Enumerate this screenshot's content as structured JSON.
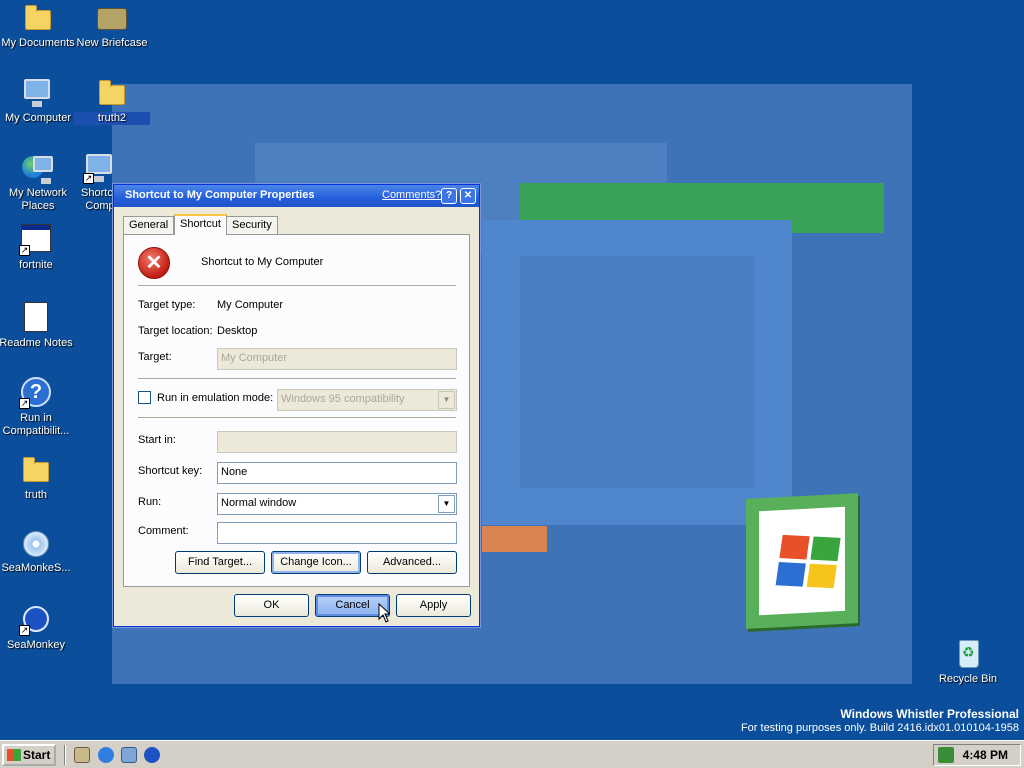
{
  "desktop_icons": [
    {
      "label": "My Documents",
      "icon": "my-documents-icon"
    },
    {
      "label": "New Briefcase",
      "icon": "briefcase-icon"
    },
    {
      "label": "My Computer",
      "icon": "my-computer-icon"
    },
    {
      "label": "truth2",
      "icon": "folder-icon"
    },
    {
      "label": "My Network Places",
      "icon": "network-places-icon"
    },
    {
      "label": "Shortcu Comp",
      "icon": "shortcut-my-computer-icon"
    },
    {
      "label": "fortnite",
      "icon": "app-window-icon"
    },
    {
      "label": "Readme Notes",
      "icon": "document-icon"
    },
    {
      "label": "Run in Compatibilit...",
      "icon": "help-icon"
    },
    {
      "label": "truth",
      "icon": "folder-icon"
    },
    {
      "label": "SeaMonkeS...",
      "icon": "cd-icon"
    },
    {
      "label": "SeaMonkey",
      "icon": "seamonkey-icon"
    },
    {
      "label": "Recycle Bin",
      "icon": "recycle-bin-icon"
    }
  ],
  "dialog": {
    "title": "Shortcut to My Computer Properties",
    "comments_link": "Comments?",
    "help_glyph": "?",
    "close_glyph": "✕",
    "tabs": [
      {
        "label": "General",
        "active": false
      },
      {
        "label": "Shortcut",
        "active": true
      },
      {
        "label": "Security",
        "active": false
      }
    ],
    "icon": "error-x-icon",
    "icon_glyph": "✕",
    "name": "Shortcut to My Computer",
    "target_type_label": "Target type:",
    "target_type_value": "My Computer",
    "target_location_label": "Target location:",
    "target_location_value": "Desktop",
    "target_label": "Target:",
    "target_value": "My Computer",
    "emulation_label": "Run in emulation mode:",
    "emulation_checked": false,
    "emulation_value": "Windows 95 compatibility",
    "start_in_label": "Start in:",
    "start_in_value": "",
    "shortcut_key_label": "Shortcut key:",
    "shortcut_key_value": "None",
    "run_label": "Run:",
    "run_value": "Normal window",
    "comment_label": "Comment:",
    "comment_value": "",
    "find_target_button": "Find Target...",
    "change_icon_button": "Change Icon...",
    "advanced_button": "Advanced...",
    "ok_button": "OK",
    "cancel_button": "Cancel",
    "apply_button": "Apply",
    "dropdown_glyph": "▼"
  },
  "watermark": {
    "line1": "Windows Whistler Professional",
    "line2": "For testing purposes only. Build 2416.idx01.010104-1958"
  },
  "taskbar": {
    "start_label": "Start",
    "quick_launch": [
      "show-desktop-icon",
      "internet-explorer-icon",
      "network-icon",
      "seamonkey-icon"
    ],
    "clock": "4:48 PM"
  },
  "colors": {
    "desktop": "#0b4f9c",
    "title_bar": "#245edb",
    "dialog_face": "#ece9d8"
  }
}
